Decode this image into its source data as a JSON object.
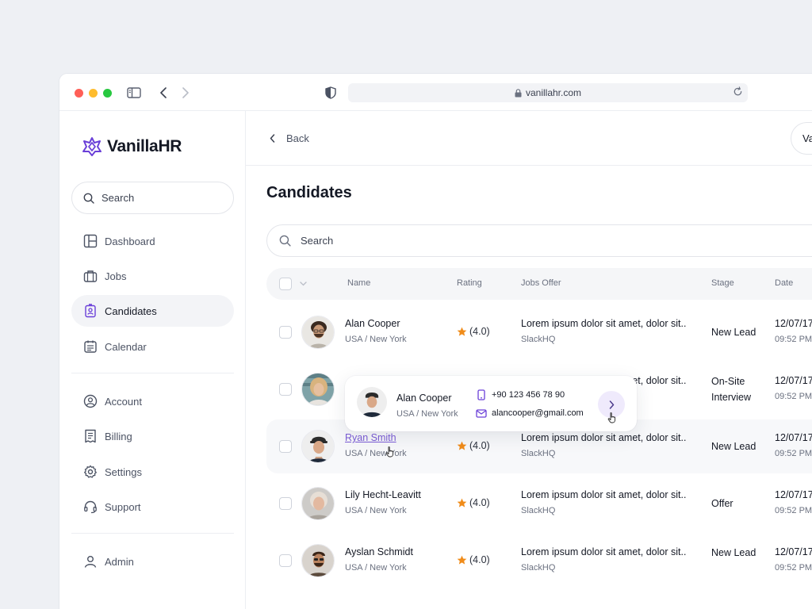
{
  "browser": {
    "url": "vanillahr.com"
  },
  "app": {
    "logo_text": "VanillaHR",
    "brand_color": "#6a3fd8"
  },
  "sidebar": {
    "search_placeholder": "Search",
    "items": [
      {
        "label": "Dashboard",
        "icon": "dashboard-icon"
      },
      {
        "label": "Jobs",
        "icon": "briefcase-icon"
      },
      {
        "label": "Candidates",
        "icon": "id-badge-icon",
        "active": true
      },
      {
        "label": "Calendar",
        "icon": "calendar-icon"
      },
      {
        "label": "Account",
        "icon": "user-circle-icon"
      },
      {
        "label": "Billing",
        "icon": "receipt-icon"
      },
      {
        "label": "Settings",
        "icon": "gear-icon"
      },
      {
        "label": "Support",
        "icon": "headset-icon"
      },
      {
        "label": "Admin",
        "icon": "user-icon"
      }
    ]
  },
  "header": {
    "back_label": "Back",
    "user_initials": "Va"
  },
  "page": {
    "title": "Candidates",
    "search_placeholder": "Search"
  },
  "table": {
    "columns": [
      "Name",
      "Rating",
      "Jobs Offer",
      "Stage",
      "Date"
    ],
    "rows": [
      {
        "name": "Alan Cooper",
        "location": "USA / New York",
        "rating": "(4.0)",
        "job": "Lorem ipsum dolor sit amet, dolor sit..",
        "company": "SlackHQ",
        "stage": "New Lead",
        "date": "12/07/17",
        "time": "09:52 PM"
      },
      {
        "name": "",
        "location": "",
        "rating": "",
        "job": "Lorem ipsum dolor sit amet, dolor sit..",
        "company": "",
        "stage": "On-Site Interview",
        "date": "12/07/17",
        "time": "09:52 PM"
      },
      {
        "name": "Ryan Smith",
        "location": "USA / New York",
        "rating": "(4.0)",
        "job": "Lorem ipsum dolor sit amet, dolor sit..",
        "company": "SlackHQ",
        "stage": "New Lead",
        "date": "12/07/17",
        "time": "09:52 PM"
      },
      {
        "name": "Lily Hecht-Leavitt",
        "location": "USA / New York",
        "rating": "(4.0)",
        "job": "Lorem ipsum dolor sit amet, dolor sit..",
        "company": "SlackHQ",
        "stage": "Offer",
        "date": "12/07/17",
        "time": "09:52 PM"
      },
      {
        "name": "Ayslan Schmidt",
        "location": "USA / New York",
        "rating": "(4.0)",
        "job": "Lorem ipsum dolor sit amet, dolor sit..",
        "company": "SlackHQ",
        "stage": "New Lead",
        "date": "12/07/17",
        "time": "09:52 PM"
      }
    ]
  },
  "popup": {
    "name": "Alan Cooper",
    "location": "USA / New York",
    "phone": "+90 123 456 78 90",
    "email": "alancooper@gmail.com"
  },
  "colors": {
    "star": "#f08c1a",
    "link": "#7b5cd6"
  }
}
